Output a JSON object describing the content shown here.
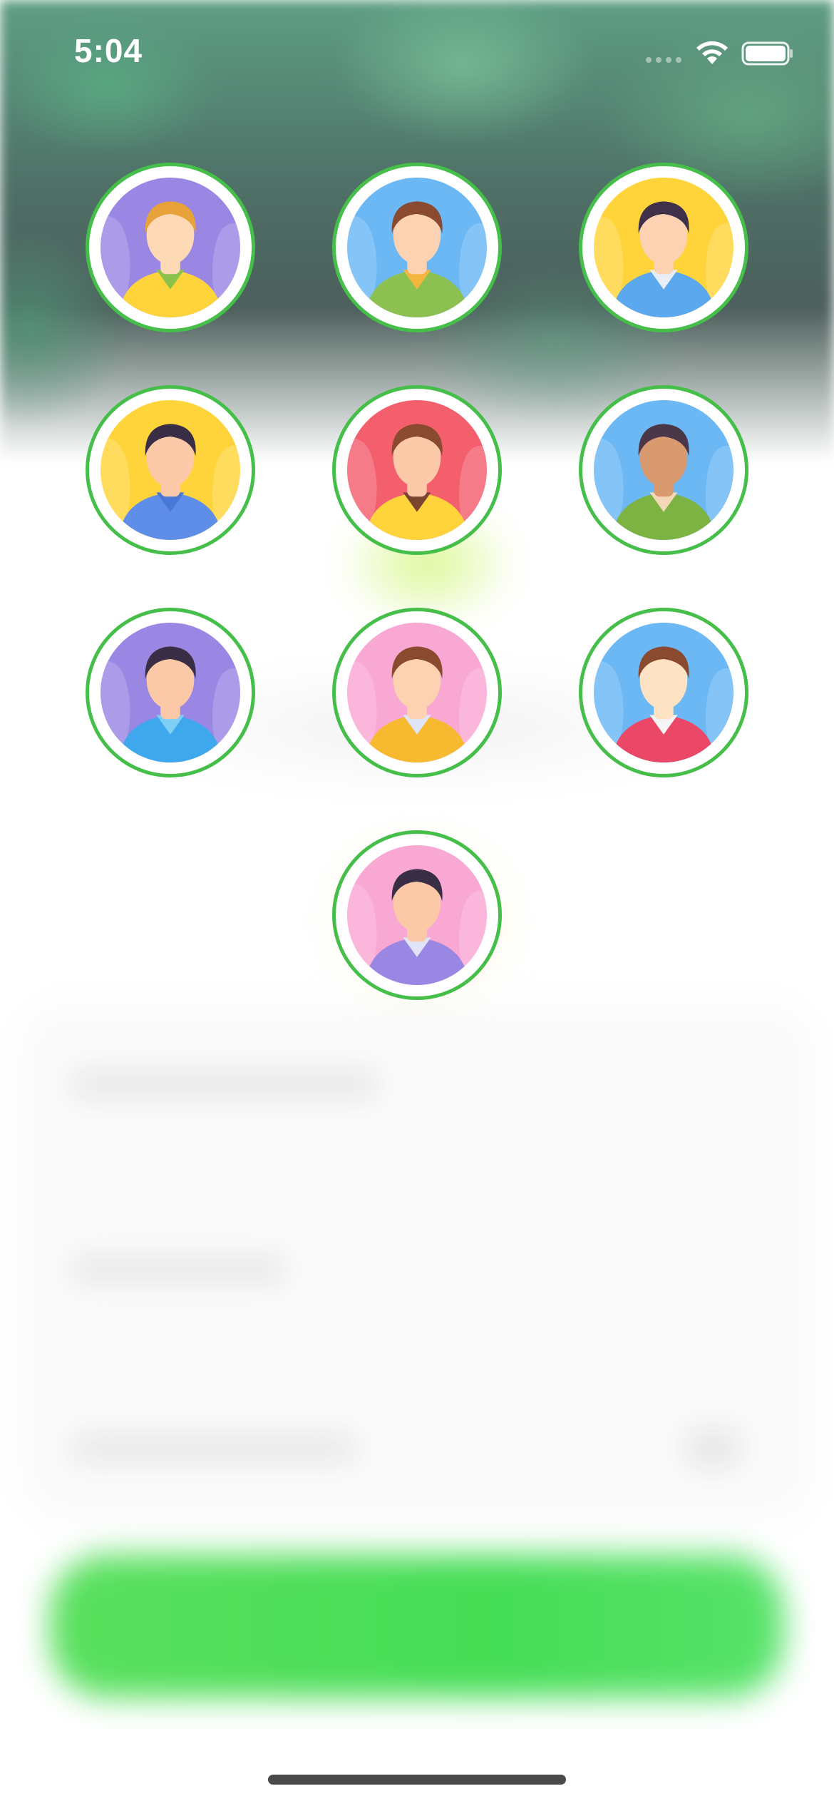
{
  "status_bar": {
    "time": "5:04",
    "icons": [
      "signal-dots-icon",
      "wifi-icon",
      "battery-icon"
    ]
  },
  "avatar_picker": {
    "ring_color": "#45be4a",
    "avatars": [
      {
        "name": "avatar-blond-man-scarf",
        "bg": "#9a86e3",
        "skin": "#fdd9b5",
        "hair": "#e8a23a",
        "shirt": "#ffd43b",
        "accent": "#8bc34a"
      },
      {
        "name": "avatar-brown-hair-woman-scarf",
        "bg": "#6bb8f5",
        "skin": "#fcd2b2",
        "hair": "#8a4a2f",
        "shirt": "#8cc152",
        "accent": "#f4b63f"
      },
      {
        "name": "avatar-dark-hair-woman-blouse",
        "bg": "#ffd43b",
        "skin": "#fcd2b2",
        "hair": "#3f3149",
        "shirt": "#5ba8ee",
        "accent": "#e8eef8"
      },
      {
        "name": "avatar-ponytail-woman",
        "bg": "#ffd43b",
        "skin": "#fcc9a8",
        "hair": "#3a2e47",
        "shirt": "#5e8ee8",
        "accent": "#4a78d6"
      },
      {
        "name": "avatar-bearded-man-hoodie",
        "bg": "#f45f6e",
        "skin": "#fcc9a8",
        "hair": "#8a4a2f",
        "shirt": "#ffd43b",
        "accent": "#7a4430"
      },
      {
        "name": "avatar-curly-hair-woman",
        "bg": "#6bb8f5",
        "skin": "#d89a6e",
        "hair": "#4a3747",
        "shirt": "#7cb342",
        "accent": "#f2d7b9"
      },
      {
        "name": "avatar-dark-hair-woman-sweater",
        "bg": "#9a86e3",
        "skin": "#fcc9a8",
        "hair": "#3a2e47",
        "shirt": "#3fa8ec",
        "accent": "#7fd0f7"
      },
      {
        "name": "avatar-brown-hair-woman-jacket",
        "bg": "#f9a8d4",
        "skin": "#fcd2b2",
        "hair": "#8a4a2f",
        "shirt": "#f6b930",
        "accent": "#dfe5f6"
      },
      {
        "name": "avatar-man-red-shirt",
        "bg": "#6bb8f5",
        "skin": "#fde2c4",
        "hair": "#8a4a2f",
        "shirt": "#ea4866",
        "accent": "#f5f5f5"
      },
      {
        "name": "avatar-dark-hair-woman-purple-jacket",
        "bg": "#f9a8d4",
        "skin": "#fcc9a8",
        "hair": "#3a2e47",
        "shirt": "#9a86e3",
        "accent": "#dfe5f6"
      }
    ]
  }
}
